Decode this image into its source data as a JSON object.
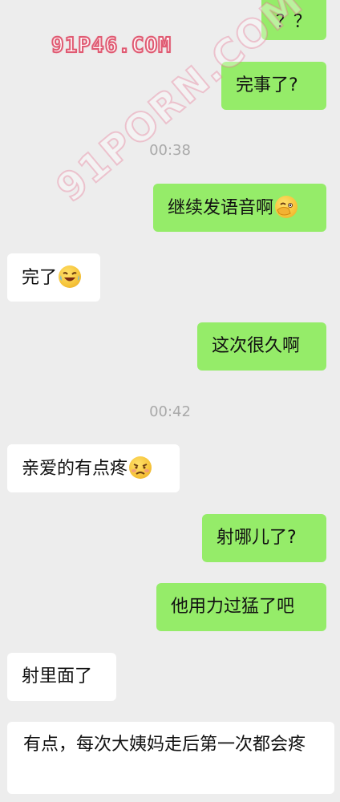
{
  "watermarks": {
    "top": "91P46.COM",
    "diagonal": "91PORN.COM"
  },
  "messages": [
    {
      "side": "out",
      "text": "？？"
    },
    {
      "side": "out",
      "text": "完事了?"
    },
    {
      "time": "00:38"
    },
    {
      "side": "out",
      "text": "继续发语音啊",
      "emoji": "cover-face-laughing-emoji"
    },
    {
      "side": "in",
      "text": "完了",
      "emoji": "crying-laughing-emoji"
    },
    {
      "side": "out",
      "text": "这次很久啊"
    },
    {
      "time": "00:42"
    },
    {
      "side": "in",
      "text": "亲爱的有点疼",
      "emoji": "pained-face-emoji"
    },
    {
      "side": "out",
      "text": "射哪儿了?"
    },
    {
      "side": "out",
      "text": "他用力过猛了吧"
    },
    {
      "side": "in",
      "text": "射里面了"
    },
    {
      "side": "in",
      "text": "有点，每次大姨妈走后第一次都会疼"
    }
  ],
  "colors": {
    "background": "#ededed",
    "outgoing_bubble": "#95ec69",
    "incoming_bubble": "#ffffff",
    "timestamp": "#a9a9a9"
  }
}
